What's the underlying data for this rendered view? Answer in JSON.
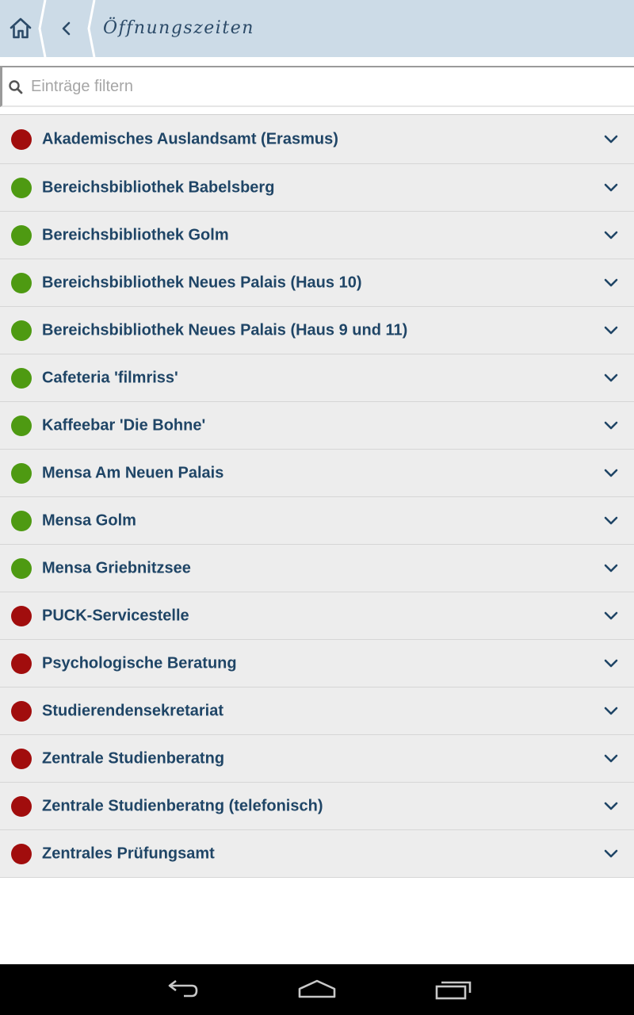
{
  "header": {
    "title": "Öffnungszeiten",
    "home_icon": "home-icon",
    "back_icon": "chevron-left-icon",
    "background": "#ccdbe7"
  },
  "search": {
    "placeholder": "Einträge filtern",
    "value": "",
    "icon": "search-icon"
  },
  "colors": {
    "open": "#4e9a12",
    "closed": "#a10d0d",
    "text": "#1f4566",
    "row_background": "#ededed"
  },
  "list": {
    "items": [
      {
        "label": "Akademisches Auslandsamt (Erasmus)",
        "status": "closed"
      },
      {
        "label": "Bereichsbibliothek Babelsberg",
        "status": "open"
      },
      {
        "label": "Bereichsbibliothek Golm",
        "status": "open"
      },
      {
        "label": "Bereichsbibliothek Neues Palais (Haus 10)",
        "status": "open"
      },
      {
        "label": "Bereichsbibliothek Neues Palais (Haus 9 und 11)",
        "status": "open"
      },
      {
        "label": "Cafeteria 'filmriss'",
        "status": "open"
      },
      {
        "label": "Kaffeebar 'Die Bohne'",
        "status": "open"
      },
      {
        "label": "Mensa Am Neuen Palais",
        "status": "open"
      },
      {
        "label": "Mensa Golm",
        "status": "open"
      },
      {
        "label": "Mensa Griebnitzsee",
        "status": "open"
      },
      {
        "label": "PUCK-Servicestelle",
        "status": "closed"
      },
      {
        "label": "Psychologische Beratung",
        "status": "closed"
      },
      {
        "label": "Studierendensekretariat",
        "status": "closed"
      },
      {
        "label": "Zentrale Studienberatng",
        "status": "closed"
      },
      {
        "label": "Zentrale Studienberatng (telefonisch)",
        "status": "closed"
      },
      {
        "label": "Zentrales Prüfungsamt",
        "status": "closed"
      }
    ]
  },
  "navbar": {
    "buttons": [
      "back-nav-icon",
      "home-nav-icon",
      "recent-apps-icon"
    ]
  }
}
